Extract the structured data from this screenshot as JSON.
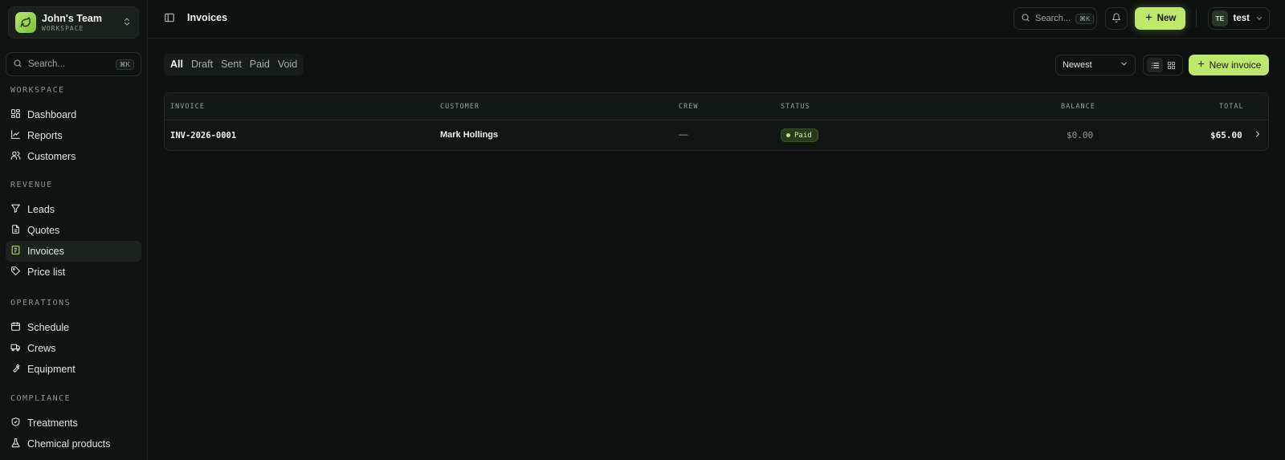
{
  "sidebar": {
    "team": {
      "name": "John's Team",
      "subtitle": "WORKSPACE"
    },
    "search": {
      "placeholder": "Search...",
      "shortcut": "⌘K"
    },
    "sections": {
      "workspace": "WORKSPACE",
      "revenue": "REVENUE",
      "operations": "OPERATIONS",
      "compliance": "COMPLIANCE"
    },
    "items": {
      "dashboard": "Dashboard",
      "reports": "Reports",
      "customers": "Customers",
      "leads": "Leads",
      "quotes": "Quotes",
      "invoices": "Invoices",
      "price_list": "Price list",
      "schedule": "Schedule",
      "crews": "Crews",
      "equipment": "Equipment",
      "treatments": "Treatments",
      "chemical_products": "Chemical products"
    },
    "active_item": "invoices"
  },
  "topbar": {
    "title": "Invoices",
    "search": {
      "placeholder": "Search...",
      "shortcut": "⌘K"
    },
    "new_label": "New",
    "user": {
      "initials": "TE",
      "name": "test"
    }
  },
  "filters": {
    "tabs": [
      "All",
      "Draft",
      "Sent",
      "Paid",
      "Void"
    ],
    "active_tab": "All",
    "sort": "Newest",
    "new_invoice_label": "New invoice"
  },
  "table": {
    "headers": {
      "invoice": "INVOICE",
      "customer": "CUSTOMER",
      "crew": "CREW",
      "status": "STATUS",
      "balance": "BALANCE",
      "total": "TOTAL"
    },
    "rows": [
      {
        "invoice": "INV-2026-0001",
        "customer": "Mark Hollings",
        "crew": "—",
        "status": "Paid",
        "balance": "$0.00",
        "total": "$65.00"
      }
    ]
  },
  "colors": {
    "accent": "#bde86b",
    "background": "#0d110f",
    "sidebar": "#0f1412"
  }
}
